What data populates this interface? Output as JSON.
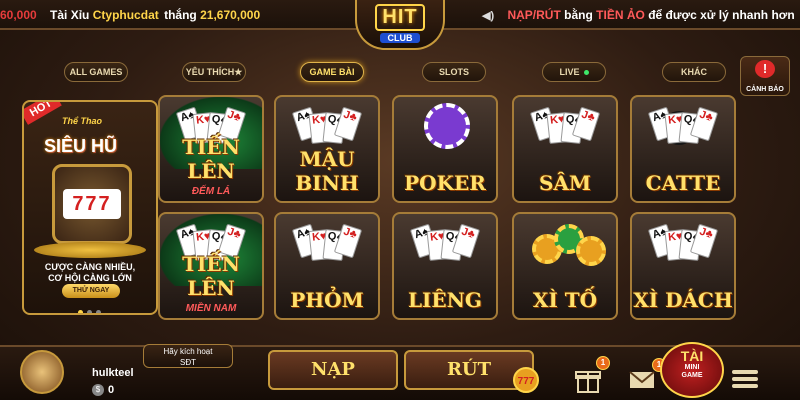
{
  "ticker": {
    "left_amount": "60,000",
    "game_name": "Tài Xỉu",
    "username": "Ctyphucdat",
    "won_label": "thắng",
    "won_amount": "21,670,000",
    "notice_part1": "NẠP/RÚT",
    "notice_part2": "bằng",
    "notice_part3": "TIỀN ẢO",
    "notice_part4": "để được xử lý nhanh hơn"
  },
  "logo": {
    "main": "HIT",
    "sub": "CLUB"
  },
  "nav": {
    "tabs": [
      {
        "label": "ALL GAMES",
        "active": false
      },
      {
        "label": "YÊU THÍCH★",
        "active": false
      },
      {
        "label": "GAME BÀI",
        "active": true
      },
      {
        "label": "SLOTS",
        "active": false
      },
      {
        "label": "LIVE",
        "active": false
      },
      {
        "label": "KHÁC",
        "active": false
      }
    ],
    "warning_label": "CẢNH BÁO"
  },
  "promo": {
    "badge": "HOT",
    "subtitle": "Thể Thao",
    "title": "SIÊU HŨ",
    "reels": "777",
    "line1": "CƯỢC CÀNG NHIỀU,",
    "line2": "CƠ HỘI CÀNG LỚN",
    "button": "THỬ NGAY"
  },
  "games": [
    {
      "label": "TIẾN LÊN",
      "sublabel": "ĐẾM LÁ",
      "art": "felt"
    },
    {
      "label": "MẬU BINH",
      "sublabel": "",
      "art": "cards"
    },
    {
      "label": "POKER",
      "sublabel": "",
      "art": "chip"
    },
    {
      "label": "SÂM",
      "sublabel": "",
      "art": "royal"
    },
    {
      "label": "CATTE",
      "sublabel": "",
      "art": "bomb"
    },
    {
      "label": "TIẾN LÊN",
      "sublabel": "MIỀN NAM",
      "art": "felt"
    },
    {
      "label": "PHỎM",
      "sublabel": "",
      "art": "cards"
    },
    {
      "label": "LIÊNG",
      "sublabel": "",
      "art": "cards"
    },
    {
      "label": "XÌ TỐ",
      "sublabel": "",
      "art": "chips"
    },
    {
      "label": "XÌ DÁCH",
      "sublabel": "",
      "art": "cards"
    }
  ],
  "bottom": {
    "activate_line1": "Hãy kích hoạt",
    "activate_line2": "SĐT",
    "username": "hulkteel",
    "coin_symbol": "$",
    "balance": "0",
    "deposit": "NẠP",
    "withdraw": "RÚT",
    "gift_badge": "1",
    "mail_badge": "1",
    "mini_tai": "TÀI",
    "mini_label1": "MINI",
    "mini_label2": "GAME"
  },
  "colors": {
    "accent": "#ffd54a",
    "border": "#c79a3c",
    "alert": "#e02a2a"
  }
}
